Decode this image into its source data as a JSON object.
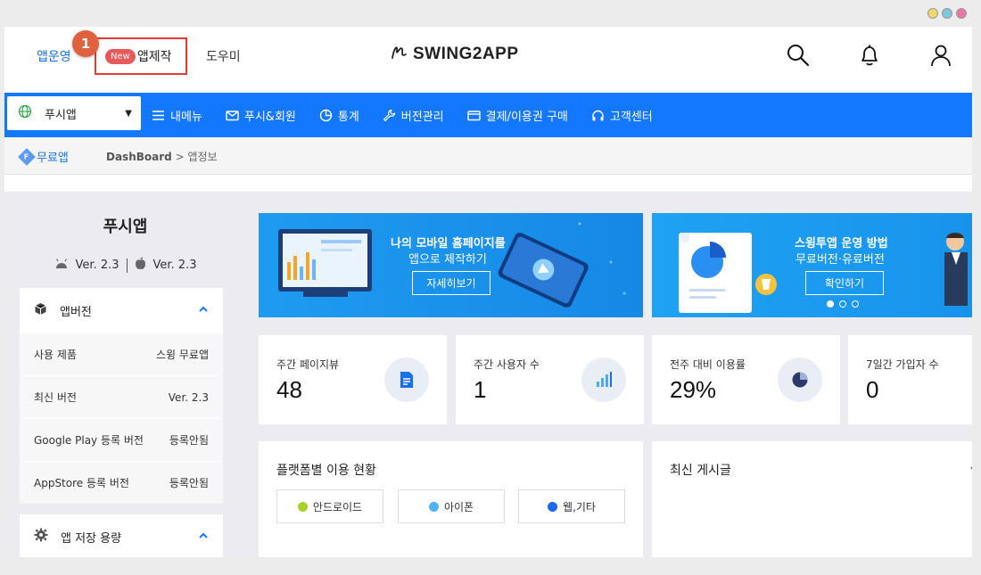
{
  "window": {
    "controls": [
      "yellow",
      "teal",
      "pink"
    ]
  },
  "header": {
    "nav_app_manage": "앱운영",
    "new_badge": "New",
    "nav_app_create": "앱제작",
    "step_badge": "1",
    "nav_help": "도우미",
    "logo_text": "SWING2APP",
    "icons": [
      "search-icon",
      "bell-icon",
      "user-icon"
    ]
  },
  "menubar": {
    "app_select": "푸시앱",
    "items": [
      {
        "label": "내메뉴",
        "icon": "menu-icon"
      },
      {
        "label": "푸시&회원",
        "icon": "mail-icon"
      },
      {
        "label": "통계",
        "icon": "pie-icon"
      },
      {
        "label": "버전관리",
        "icon": "wrench-icon"
      },
      {
        "label": "결제/이용권 구매",
        "icon": "card-icon"
      },
      {
        "label": "고객센터",
        "icon": "headset-icon"
      }
    ]
  },
  "breadcrumb": {
    "free_letter": "F",
    "free_label": "무료앱",
    "path_root": "DashBoard",
    "path_sep": ">",
    "path_current": "앱정보"
  },
  "sidebar": {
    "title": "푸시앱",
    "android_version": "Ver. 2.3",
    "ios_version": "Ver. 2.3",
    "version_box": {
      "title": "앱버전",
      "rows": [
        {
          "label": "사용 제품",
          "value": "스윙 무료앱"
        },
        {
          "label": "최신 버전",
          "value": "Ver. 2.3"
        },
        {
          "label": "Google Play 등록 버전",
          "value": "등록안됨"
        },
        {
          "label": "AppStore 등록 버전",
          "value": "등록안됨"
        }
      ]
    },
    "storage_box": {
      "title": "앱 저장 용량"
    }
  },
  "banners": [
    {
      "title": "나의 모바일 홈페이지를",
      "sub": "앱으로 제작하기",
      "button": "자세히보기"
    },
    {
      "title": "스윙투앱 운영 방법",
      "sub": "무료버전·유료버전",
      "button": "확인하기"
    }
  ],
  "stats": [
    {
      "label": "주간 페이지뷰",
      "value": "48",
      "icon": "document-icon"
    },
    {
      "label": "주간 사용자 수",
      "value": "1",
      "icon": "bar-chart-icon"
    },
    {
      "label": "전주 대비 이용률",
      "value": "29%",
      "icon": "pie-chart-icon"
    },
    {
      "label": "7일간 가입자 수",
      "value": "0",
      "icon": "user-plus-icon"
    }
  ],
  "platform_panel": {
    "title": "플랫폼별 이용 현황",
    "legend": [
      {
        "label": "안드로이드",
        "color": "#a6d22b"
      },
      {
        "label": "아이폰",
        "color": "#4fb3f5"
      },
      {
        "label": "웹,기타",
        "color": "#1a6af2"
      }
    ]
  },
  "recent_panel": {
    "title": "최신 게시글"
  },
  "colors": {
    "brand_blue": "#1478ff",
    "highlight_red": "#e53935",
    "step_orange": "#e0613e"
  }
}
